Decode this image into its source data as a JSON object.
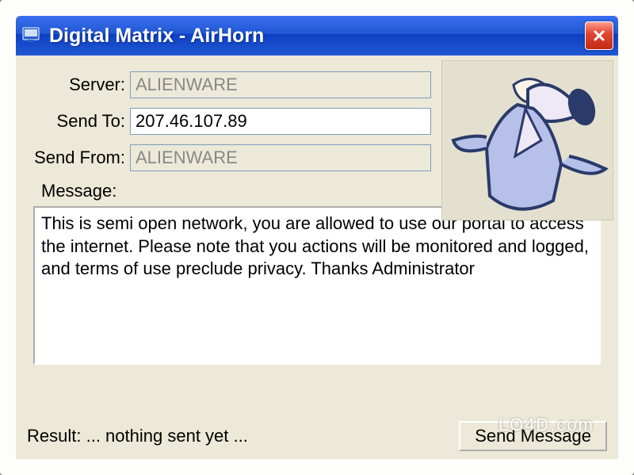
{
  "window": {
    "title": "Digital Matrix - AirHorn",
    "close_icon": "close"
  },
  "form": {
    "server": {
      "label": "Server:",
      "value": "ALIENWARE",
      "readonly": true
    },
    "send_to": {
      "label": "Send To:",
      "value": "207.46.107.89",
      "readonly": false
    },
    "send_from": {
      "label": "Send From:",
      "value": "ALIENWARE",
      "readonly": true
    },
    "message_label": "Message:",
    "message_value": "This is semi open network, you are allowed to use our portal to access the internet. Please note that you actions will be monitored and logged, and terms of use preclude privacy. Thanks Administrator"
  },
  "result": {
    "label": "Result:",
    "text": "... nothing sent yet ..."
  },
  "buttons": {
    "send_label": "Send Message"
  },
  "illustration": {
    "alt": "man-with-megaphone"
  },
  "watermark": "LO4D.com",
  "colors": {
    "titlebar_start": "#3a6ef0",
    "titlebar_end": "#0d3fc4",
    "client_bg": "#ece9d8",
    "close_red": "#e24733"
  }
}
